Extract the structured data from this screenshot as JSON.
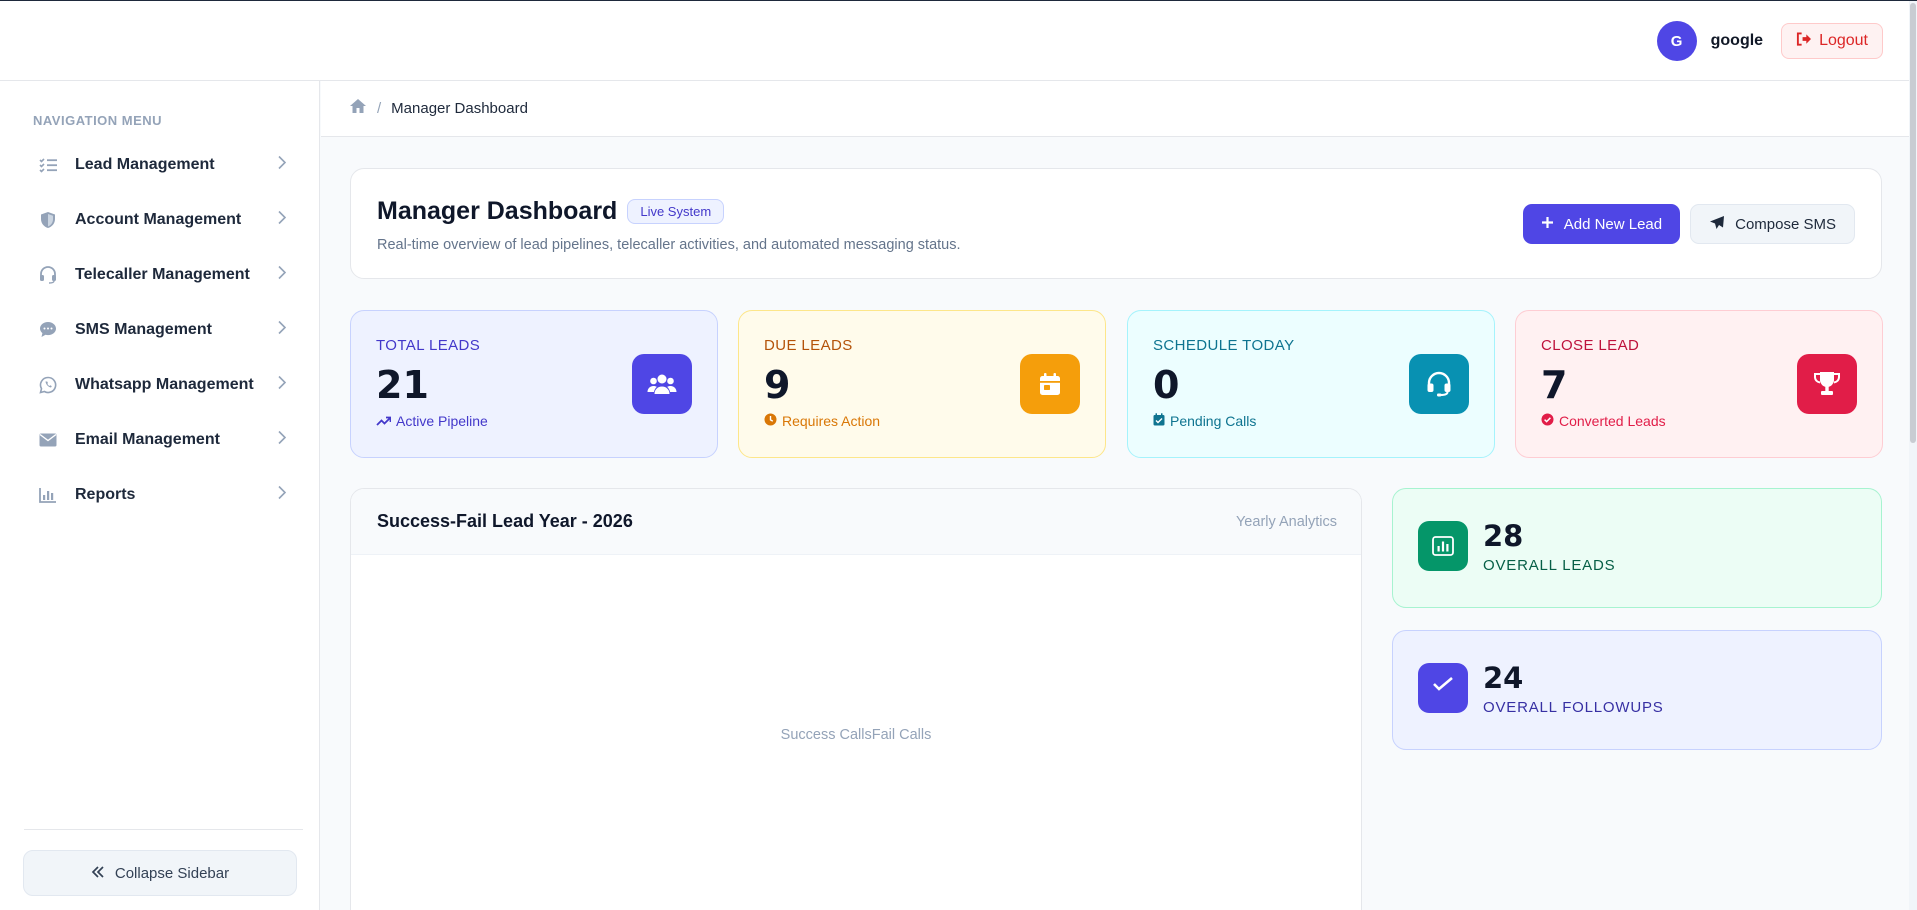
{
  "topbar": {
    "avatar_initial": "G",
    "user_name": "google",
    "logout_label": "Logout"
  },
  "sidebar": {
    "heading": "NAVIGATION MENU",
    "items": [
      {
        "label": "Lead Management",
        "icon": "list-check-icon"
      },
      {
        "label": "Account Management",
        "icon": "shield-icon"
      },
      {
        "label": "Telecaller Management",
        "icon": "headset-icon"
      },
      {
        "label": "SMS Management",
        "icon": "chat-bubble-icon"
      },
      {
        "label": "Whatsapp Management",
        "icon": "whatsapp-icon"
      },
      {
        "label": "Email Management",
        "icon": "envelope-icon"
      },
      {
        "label": "Reports",
        "icon": "bar-chart-icon"
      }
    ],
    "collapse_label": "Collapse Sidebar"
  },
  "breadcrumb": {
    "separator": "/",
    "current": "Manager Dashboard"
  },
  "header": {
    "title": "Manager Dashboard",
    "badge": "Live System",
    "subtitle": "Real-time overview of lead pipelines, telecaller activities, and automated messaging status.",
    "add_lead_label": "Add New Lead",
    "compose_sms_label": "Compose SMS"
  },
  "stats": [
    {
      "label": "TOTAL LEADS",
      "value": "21",
      "sub": "Active Pipeline",
      "accent": "#4338ca",
      "icon": "users-icon"
    },
    {
      "label": "DUE LEADS",
      "value": "9",
      "sub": "Requires Action",
      "accent": "#d97706",
      "icon": "calendar-icon"
    },
    {
      "label": "SCHEDULE TODAY",
      "value": "0",
      "sub": "Pending Calls",
      "accent": "#0e7490",
      "icon": "headset-icon"
    },
    {
      "label": "CLOSE LEAD",
      "value": "7",
      "sub": "Converted Leads",
      "accent": "#e11d48",
      "icon": "trophy-icon"
    }
  ],
  "chart": {
    "title": "Success-Fail Lead Year - 2026",
    "tag": "Yearly Analytics",
    "legend_text": "Success CallsFail Calls"
  },
  "overall": [
    {
      "value": "28",
      "label": "OVERALL LEADS",
      "accent": "#059669"
    },
    {
      "value": "24",
      "label": "OVERALL FOLLOWUPS",
      "accent": "#4f46e5"
    }
  ],
  "colors": {
    "primary": "#4f46e5",
    "danger": "#dc2626"
  }
}
